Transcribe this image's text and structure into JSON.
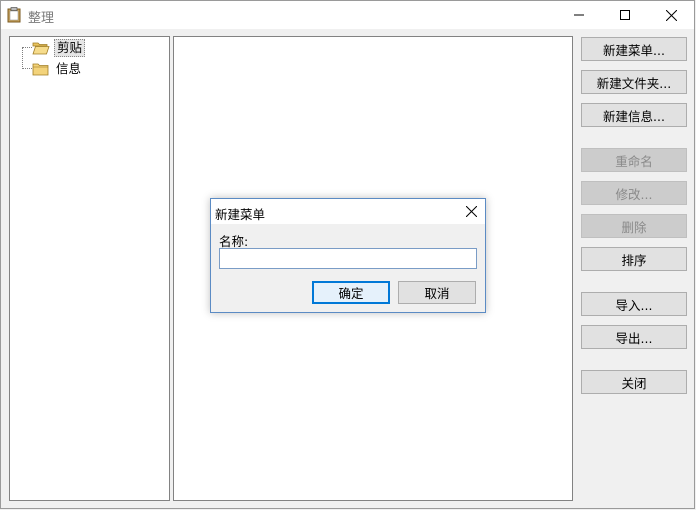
{
  "window": {
    "title": "整理",
    "controls": {
      "minimize": "minimize-icon",
      "maximize": "maximize-icon",
      "close": "close-icon"
    }
  },
  "tree": {
    "items": [
      {
        "label": "剪贴",
        "selected": true,
        "icon": "folder-open-icon"
      },
      {
        "label": "信息",
        "selected": false,
        "icon": "folder-icon"
      }
    ]
  },
  "sidebar": {
    "buttons": [
      {
        "label": "新建菜单...",
        "enabled": true
      },
      {
        "label": "新建文件夹...",
        "enabled": true
      },
      {
        "label": "新建信息...",
        "enabled": true
      },
      {
        "label": "重命名",
        "enabled": false
      },
      {
        "label": "修改...",
        "enabled": false
      },
      {
        "label": "删除",
        "enabled": false
      },
      {
        "label": "排序",
        "enabled": true
      },
      {
        "label": "导入...",
        "enabled": true
      },
      {
        "label": "导出...",
        "enabled": true
      },
      {
        "label": "关闭",
        "enabled": true
      }
    ]
  },
  "dialog": {
    "title": "新建菜单",
    "name_label": "名称:",
    "name_value": "",
    "ok_label": "确定",
    "cancel_label": "取消"
  },
  "colors": {
    "accent": "#0078d7",
    "folder": "#f3d37b"
  }
}
